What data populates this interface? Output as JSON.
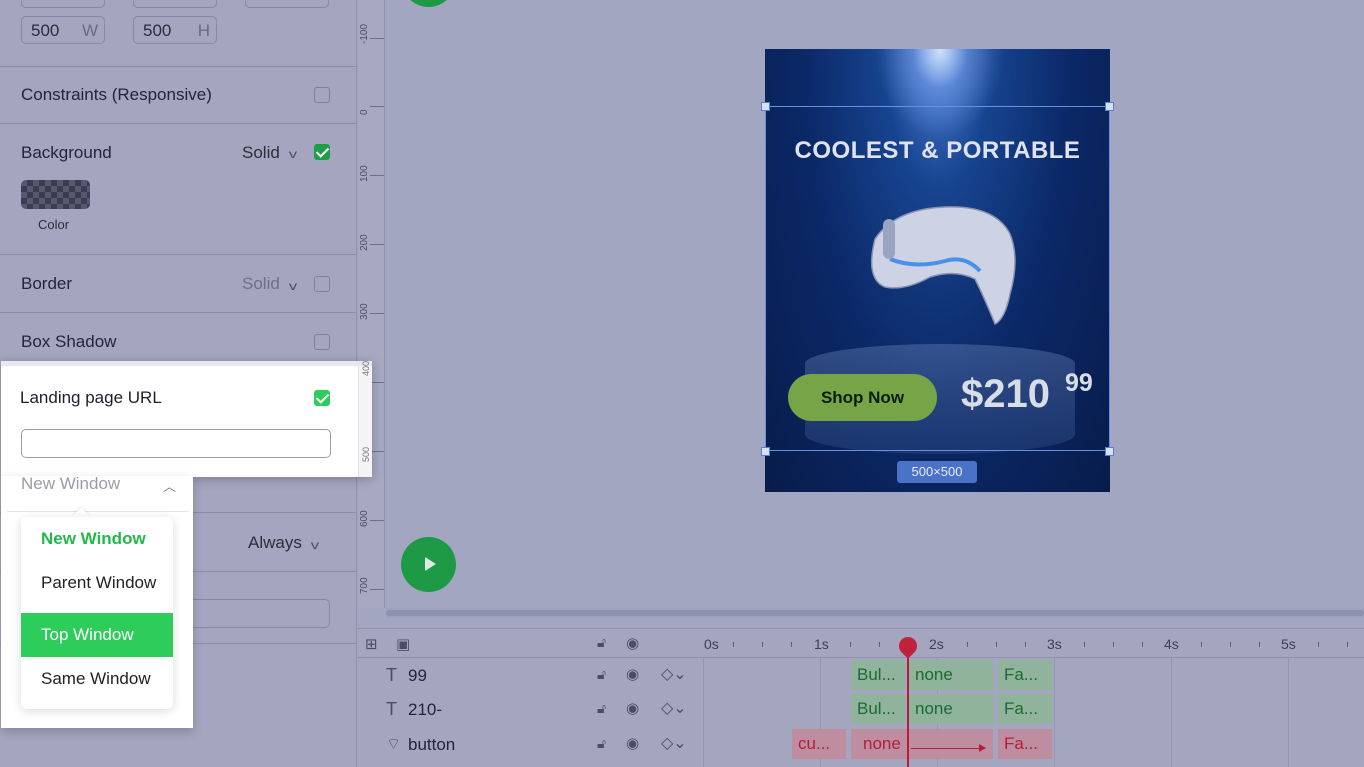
{
  "left_panel": {
    "size": {
      "width": "500",
      "width_suffix": "W",
      "height": "500",
      "height_suffix": "H"
    },
    "constraints_label": "Constraints (Responsive)",
    "background": {
      "label": "Background",
      "mode": "Solid",
      "swatch_label": "Color"
    },
    "border": {
      "label": "Border",
      "mode": "Solid"
    },
    "box_shadow": {
      "label": "Box Shadow"
    },
    "landing_page": {
      "label": "Landing page URL",
      "url_value": "",
      "target": "New Window",
      "menu": [
        "New Window",
        "Parent Window",
        "Top Window",
        "Same Window"
      ],
      "selected": "New Window",
      "hovered": "Top Window"
    },
    "repeat": {
      "value": "Always"
    }
  },
  "ruler": [
    "-100",
    "0",
    "100",
    "200",
    "300",
    "400",
    "500",
    "600",
    "700"
  ],
  "ad": {
    "headline": "COOLEST & PORTABLE",
    "cta": "Shop Now",
    "price": "$210",
    "price_cents": "99",
    "size_badge": "500×500"
  },
  "timeline": {
    "seconds": [
      "0s",
      "1s",
      "2s",
      "3s",
      "4s",
      "5s"
    ],
    "layers": [
      {
        "type": "T",
        "name": "99",
        "cells": [
          "Bul...",
          "none",
          "Fa..."
        ]
      },
      {
        "type": "T",
        "name": "210-",
        "cells": [
          "Bul...",
          "none",
          "Fa..."
        ]
      },
      {
        "type": "button",
        "name": "button",
        "cells": [
          "cu...",
          "none",
          "Fa..."
        ]
      }
    ]
  },
  "colors": {
    "accent_green": "#2ecc5b",
    "playhead": "#c0223c"
  }
}
